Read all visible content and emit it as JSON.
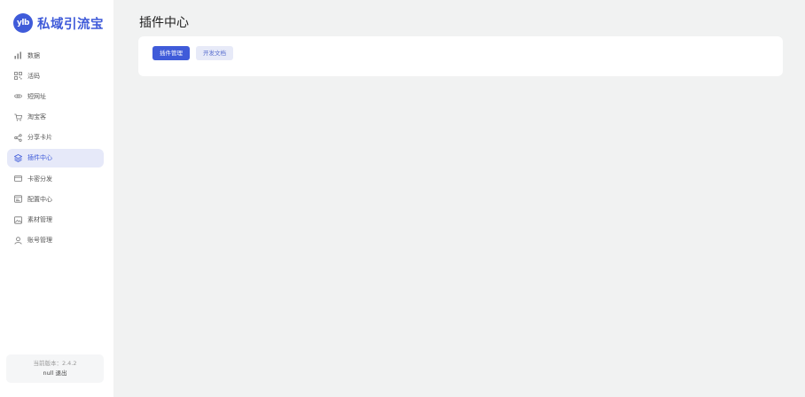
{
  "brand": {
    "logo_text": "ylb",
    "name": "私域引流宝",
    "accent": "#3f5bd9"
  },
  "sidebar": {
    "items": [
      {
        "label": "数据",
        "icon": "bar-chart-icon",
        "active": false
      },
      {
        "label": "活码",
        "icon": "qr-code-icon",
        "active": false
      },
      {
        "label": "短网址",
        "icon": "link-icon",
        "active": false
      },
      {
        "label": "淘宝客",
        "icon": "cart-icon",
        "active": false
      },
      {
        "label": "分享卡片",
        "icon": "share-icon",
        "active": false
      },
      {
        "label": "插件中心",
        "icon": "layers-icon",
        "active": true
      },
      {
        "label": "卡密分发",
        "icon": "card-icon",
        "active": false
      },
      {
        "label": "配置中心",
        "icon": "settings-window-icon",
        "active": false
      },
      {
        "label": "素材管理",
        "icon": "image-icon",
        "active": false
      },
      {
        "label": "账号管理",
        "icon": "user-icon",
        "active": false
      }
    ],
    "version_label": "当前版本：2.4.2",
    "user_name": "null",
    "logout_label": "退出"
  },
  "main": {
    "title": "插件中心",
    "tabs": [
      {
        "label": "插件管理",
        "active": true
      },
      {
        "label": "开发文档",
        "active": false
      }
    ]
  }
}
